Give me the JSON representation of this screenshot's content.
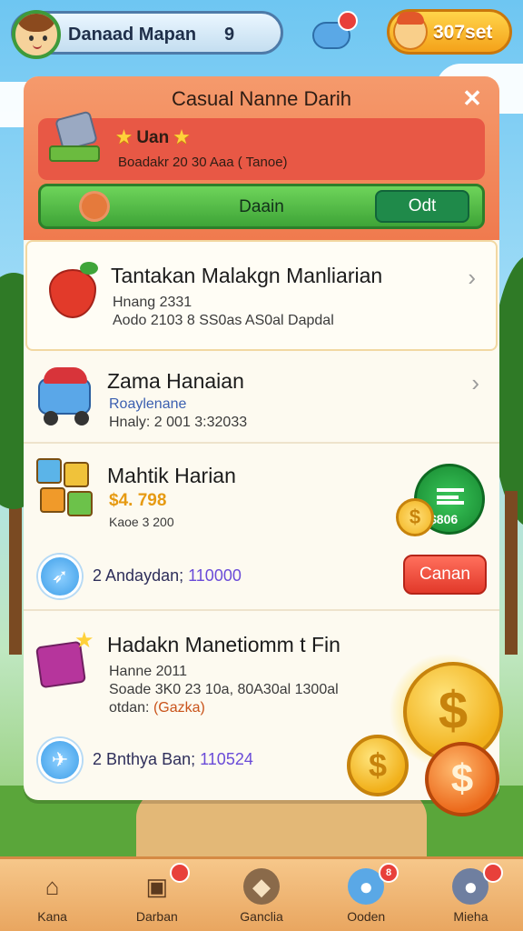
{
  "hud": {
    "player_name": "Danaad Mapan",
    "level": "9",
    "pet_badge": "",
    "coins": "307set"
  },
  "panel": {
    "title": "Casual Nanne Darih",
    "close_icon": "close-icon",
    "featured": {
      "title": "Uan",
      "subtitle": "Boadakr 20 30 Aaa ( Tanoe)",
      "play_label": "Daain",
      "odd_label": "Odt"
    },
    "items": [
      {
        "title": "Tantakan Malakgn Manliarian",
        "line1": "Hnang 2331",
        "line2": "Aodo 2103 8 SS0as AS0al Dapdal",
        "icon": "strawberry-icon"
      },
      {
        "title": "Zama Hanaian",
        "line1": "Roaylenane",
        "line2": "Hnaly: 2 001 3:32033",
        "icon": "truck-icon"
      },
      {
        "title": "Mahtik Harian",
        "price": "$4. 798",
        "line2": "Kaoe 3 200",
        "money_amount": "$806",
        "coin_symbol": "$",
        "action_count": "2",
        "action_text": "Andaydan;",
        "action_number": "110000",
        "cancel_label": "Canan",
        "icon": "tiles-icon"
      },
      {
        "title": "Hadakn Manetiomm t Fin",
        "line1": "Hanne 2011",
        "line2": "Soade 3K0 23 10a, 80A30al 1300al",
        "line3_prefix": "otdan:",
        "line3_tag": "(Gazka)",
        "action_count": "2",
        "action_text": "Bnthya Ban;",
        "action_number": "110524",
        "icon": "gift-icon"
      }
    ]
  },
  "coin_symbol": "$",
  "nav": [
    {
      "label": "Kana",
      "icon": "home-icon",
      "badge": false
    },
    {
      "label": "Darban",
      "icon": "briefcase-icon",
      "badge": true,
      "badge_text": ""
    },
    {
      "label": "Ganclia",
      "icon": "compass-icon",
      "badge": false
    },
    {
      "label": "Ooden",
      "icon": "bird-icon",
      "badge": true,
      "badge_text": "8"
    },
    {
      "label": "Mieha",
      "icon": "profile-icon",
      "badge": true,
      "badge_text": ""
    }
  ],
  "colors": {
    "panel_header": "#f07a4e",
    "featured_card": "#e85845",
    "play_green": "#3ea437",
    "cancel_red": "#e2392a",
    "coin_gold": "#f1b01a",
    "nav_bg": "#e9a660"
  }
}
